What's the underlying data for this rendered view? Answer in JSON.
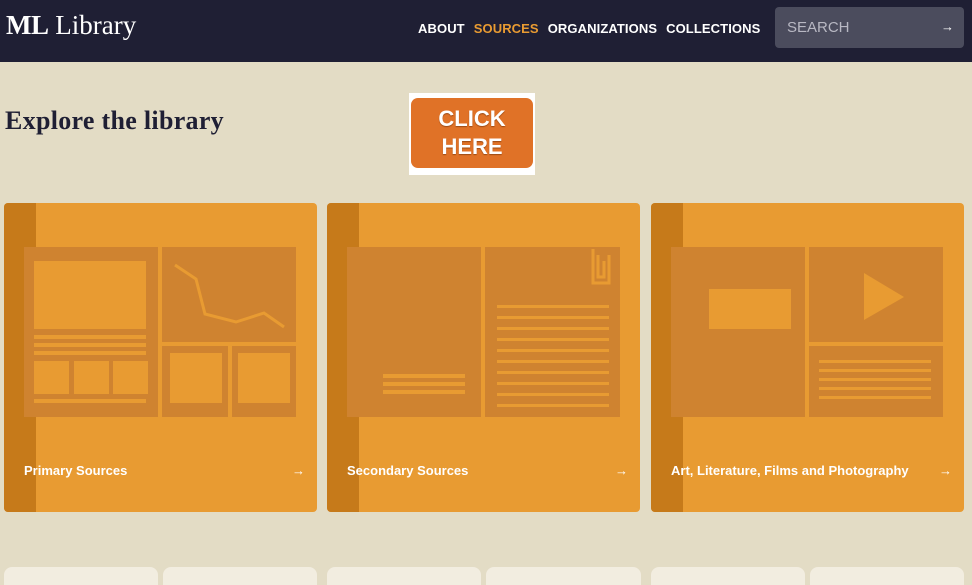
{
  "header": {
    "logo_bold": "ML",
    "logo_text": "Library",
    "nav": [
      "ABOUT",
      "SOURCES",
      "ORGANIZATIONS",
      "COLLECTIONS"
    ],
    "active_nav": "SOURCES",
    "search_placeholder": "SEARCH",
    "search_arrow": "→"
  },
  "main": {
    "title": "Explore the library",
    "cta_line1": "CLICK",
    "cta_line2": "HERE"
  },
  "cards": [
    {
      "label": "Primary Sources",
      "arrow": "→"
    },
    {
      "label": "Secondary Sources",
      "arrow": "→"
    },
    {
      "label": "Art, Literature, Films and Photography",
      "arrow": "→"
    }
  ],
  "colors": {
    "header_bg": "#1f1f34",
    "page_bg": "#e3dcc5",
    "accent": "#e89b32",
    "cta": "#e07227"
  }
}
